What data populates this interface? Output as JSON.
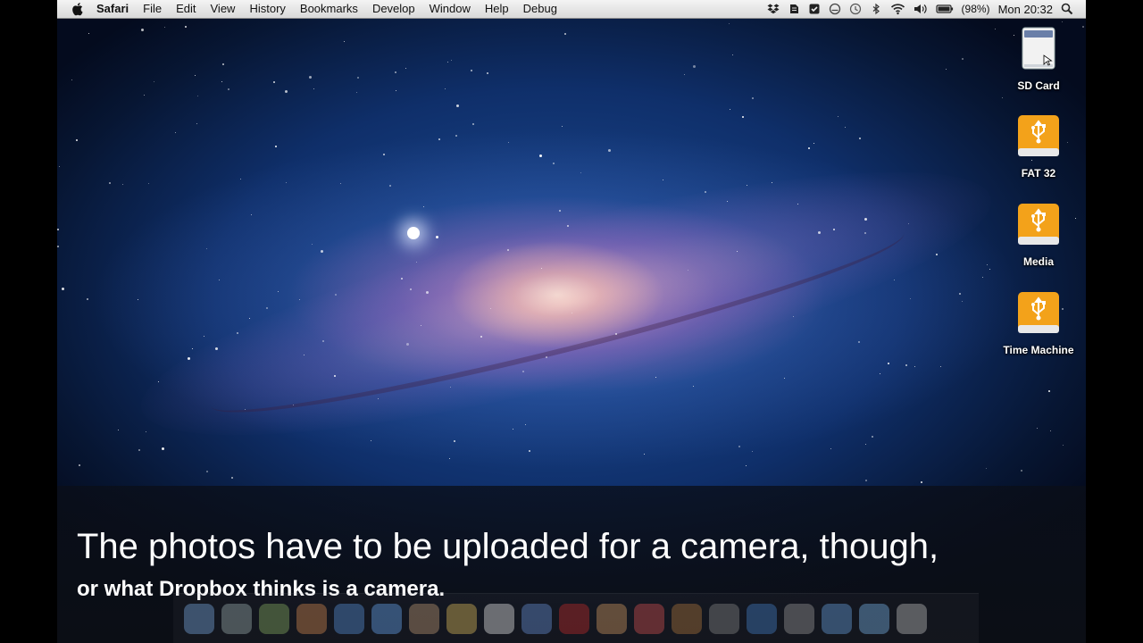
{
  "menubar": {
    "app_name": "Safari",
    "menus": [
      "File",
      "Edit",
      "View",
      "History",
      "Bookmarks",
      "Develop",
      "Window",
      "Help",
      "Debug"
    ],
    "battery_text": "(98%)",
    "clock": "Mon 20:32",
    "status_icons": [
      "dropbox-icon",
      "evernote-icon",
      "checkbox-icon",
      "cloud-icon",
      "time-machine-icon",
      "bluetooth-icon",
      "wifi-icon",
      "volume-icon",
      "battery-icon",
      "spotlight-icon"
    ]
  },
  "desktop_icons": [
    {
      "label": "SD Card",
      "icon": "sd-card-icon"
    },
    {
      "label": "FAT 32",
      "icon": "usb-drive-icon"
    },
    {
      "label": "Media",
      "icon": "usb-drive-icon"
    },
    {
      "label": "Time Machine",
      "icon": "usb-drive-icon"
    }
  ],
  "caption": {
    "line1": "The photos have to be uploaded for a camera, though,",
    "line2": "or what Dropbox thinks is a camera."
  },
  "dock": {
    "items": [
      "finder-icon",
      "launchpad-icon",
      "mission-control-icon",
      "mail-icon",
      "safari-icon",
      "app-store-icon",
      "address-book-icon",
      "notes-icon",
      "calendar-icon",
      "itunes-icon",
      "photo-booth-icon",
      "iphoto-icon",
      "preview-icon",
      "garageband-icon",
      "utility-icon",
      "quicktime-icon",
      "preferences-icon",
      "applications-folder-icon",
      "documents-folder-icon",
      "trash-icon"
    ]
  },
  "colors": {
    "drive_orange": "#f3a21a",
    "caption_band": "#0c0f18"
  }
}
